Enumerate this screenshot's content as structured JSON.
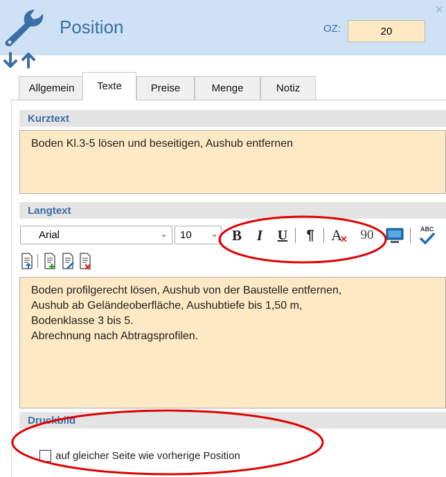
{
  "header": {
    "title": "Position",
    "oz_label": "OZ:",
    "oz_value": "20"
  },
  "tabs": [
    {
      "label": "Allgemein",
      "active": false
    },
    {
      "label": "Texte",
      "active": true
    },
    {
      "label": "Preise",
      "active": false
    },
    {
      "label": "Menge",
      "active": false
    },
    {
      "label": "Notiz",
      "active": false
    }
  ],
  "kurztext": {
    "heading": "Kurztext",
    "text": "Boden Kl.3-5 lösen und beseitigen, Aushub entfernen"
  },
  "langtext": {
    "heading": "Langtext",
    "font": "Arial",
    "size": "10",
    "toolbar": {
      "bold": "B",
      "italic": "I",
      "underline": "U",
      "paragraph": "¶",
      "clear_format": "A",
      "rotate": "90",
      "spell": "ABC"
    },
    "lines": [
      "Boden profilgerecht lösen, Aushub von der Baustelle entfernen,",
      "Aushub ab Geländeoberfläche, Aushubtiefe bis 1,50 m,",
      "Bodenklasse 3 bis 5.",
      "Abrechnung nach Abtragsprofilen."
    ]
  },
  "druckbild": {
    "heading": "Druckbild",
    "checkbox_label": "auf gleicher Seite wie vorherige Position",
    "checked": false
  },
  "colors": {
    "header_bg": "#cfe1f4",
    "accent": "#3a6ea6",
    "field_bg": "#fde9c3",
    "annotation": "#e00000"
  }
}
